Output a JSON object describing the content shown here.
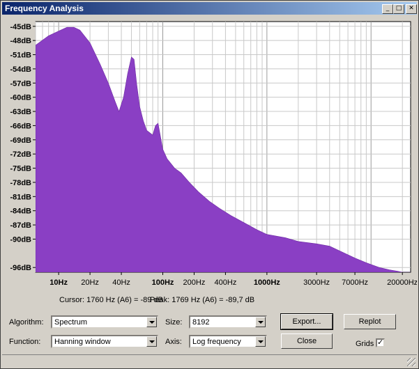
{
  "window": {
    "title": "Frequency Analysis",
    "controls": [
      "minimize",
      "maximize",
      "close"
    ]
  },
  "plot": {
    "fill_color": "#8a3fc4",
    "grid": true,
    "y_ticks": [
      "-45dB",
      "-48dB",
      "-51dB",
      "-54dB",
      "-57dB",
      "-60dB",
      "-63dB",
      "-66dB",
      "-69dB",
      "-72dB",
      "-75dB",
      "-78dB",
      "-81dB",
      "-84dB",
      "-87dB",
      "-90dB",
      "-96dB"
    ],
    "x_ticks": [
      {
        "label": "10Hz",
        "bold": true
      },
      {
        "label": "20Hz",
        "bold": false
      },
      {
        "label": "40Hz",
        "bold": false
      },
      {
        "label": "100Hz",
        "bold": true
      },
      {
        "label": "200Hz",
        "bold": false
      },
      {
        "label": "400Hz",
        "bold": false
      },
      {
        "label": "1000Hz",
        "bold": true
      },
      {
        "label": "3000Hz",
        "bold": false
      },
      {
        "label": "7000Hz",
        "bold": false
      },
      {
        "label": "20000Hz",
        "bold": false
      }
    ]
  },
  "chart_data": {
    "type": "area",
    "title": "",
    "xlabel": "",
    "ylabel": "",
    "x_scale": "log",
    "xlim": [
      6,
      24000
    ],
    "ylim": [
      -97,
      -44
    ],
    "series": [
      {
        "values_x_hz": [
          6,
          8,
          10,
          12,
          14,
          16,
          20,
          25,
          30,
          35,
          38,
          42,
          46,
          50,
          53,
          56,
          60,
          65,
          70,
          75,
          80,
          85,
          90,
          100,
          110,
          130,
          150,
          180,
          220,
          280,
          350,
          450,
          600,
          800,
          1000,
          1500,
          2000,
          3000,
          4000,
          5000,
          7000,
          9000,
          12000,
          15000,
          18000,
          20000,
          22000,
          24000
        ],
        "values_db": [
          -49,
          -47,
          -46,
          -45.2,
          -45.2,
          -45.8,
          -48.5,
          -53,
          -57,
          -61,
          -63,
          -60,
          -55,
          -51.5,
          -52,
          -57,
          -62,
          -65,
          -67,
          -67.5,
          -68,
          -66,
          -65.5,
          -71,
          -73,
          -75,
          -76,
          -78,
          -80,
          -82,
          -83.5,
          -85,
          -86.5,
          -88,
          -89,
          -89.7,
          -90.5,
          -91,
          -91.5,
          -92.5,
          -94,
          -95,
          -96,
          -96.5,
          -96.8,
          -97,
          -97,
          -97
        ]
      }
    ]
  },
  "cursor": {
    "label": "Cursor:",
    "text": "1760 Hz (A6) = -89 dB"
  },
  "peak": {
    "label": "Peak:",
    "text": "1769 Hz (A6) = -89,7 dB"
  },
  "controls": {
    "algorithm_label": "Algorithm:",
    "algorithm_value": "Spectrum",
    "function_label": "Function:",
    "function_value": "Hanning window",
    "size_label": "Size:",
    "size_value": "8192",
    "axis_label": "Axis:",
    "axis_value": "Log frequency",
    "export_label": "Export...",
    "close_label": "Close",
    "replot_label": "Replot",
    "grids_label": "Grids",
    "grids_checked": true
  }
}
